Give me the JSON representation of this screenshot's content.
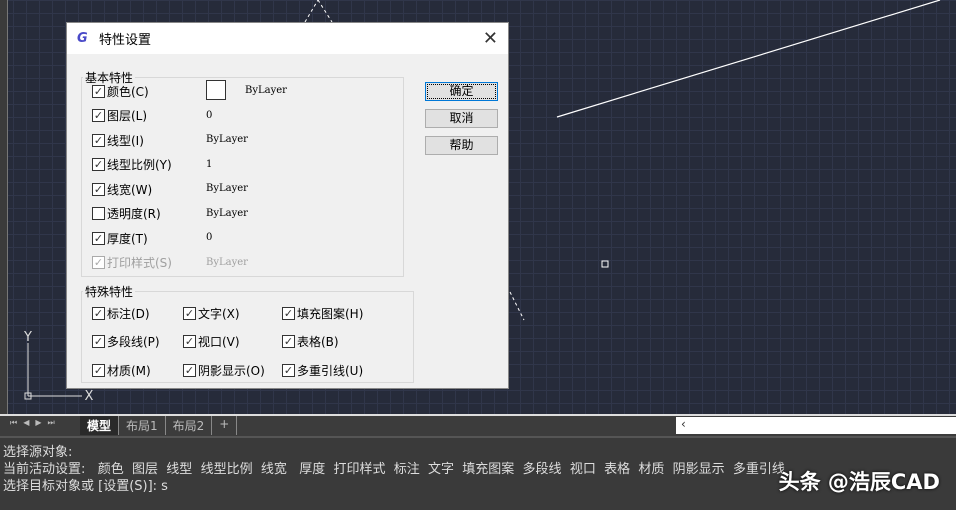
{
  "dialog": {
    "title": "特性设置",
    "close_icon": "close-icon",
    "basic": {
      "label": "基本特性",
      "items": [
        {
          "label": "颜色(C)",
          "checked": true,
          "value": "ByLayer",
          "swatch": "#ffffff"
        },
        {
          "label": "图层(L)",
          "checked": true,
          "value": "0"
        },
        {
          "label": "线型(I)",
          "checked": true,
          "value": "ByLayer"
        },
        {
          "label": "线型比例(Y)",
          "checked": true,
          "value": "1"
        },
        {
          "label": "线宽(W)",
          "checked": true,
          "value": "ByLayer"
        },
        {
          "label": "透明度(R)",
          "checked": false,
          "value": "ByLayer"
        },
        {
          "label": "厚度(T)",
          "checked": true,
          "value": "0"
        },
        {
          "label": "打印样式(S)",
          "checked": true,
          "disabled": true,
          "value": "ByLayer"
        }
      ]
    },
    "special": {
      "label": "特殊特性",
      "items": [
        {
          "label": "标注(D)",
          "checked": true
        },
        {
          "label": "文字(X)",
          "checked": true
        },
        {
          "label": "填充图案(H)",
          "checked": true
        },
        {
          "label": "多段线(P)",
          "checked": true
        },
        {
          "label": "视口(V)",
          "checked": true
        },
        {
          "label": "表格(B)",
          "checked": true
        },
        {
          "label": "材质(M)",
          "checked": true
        },
        {
          "label": "阴影显示(O)",
          "checked": true
        },
        {
          "label": "多重引线(U)",
          "checked": true
        }
      ]
    },
    "buttons": {
      "ok": "确定",
      "cancel": "取消",
      "help": "帮助"
    }
  },
  "tabs": {
    "nav": [
      "⏮",
      "◀",
      "▶",
      "⏭"
    ],
    "items": [
      "模型",
      "布局1",
      "布局2",
      "+"
    ],
    "active": "模型"
  },
  "ucs": {
    "y": "Y",
    "x": "X"
  },
  "command": {
    "lines": [
      "选择源对象:",
      "当前活动设置:   颜色  图层  线型  线型比例  线宽   厚度  打印样式  标注  文字  填充图案  多段线  视口  表格  材质  阴影显示  多重引线",
      "选择目标对象或 [设置(S)]: s"
    ]
  },
  "watermark": "头条 @浩辰CAD"
}
